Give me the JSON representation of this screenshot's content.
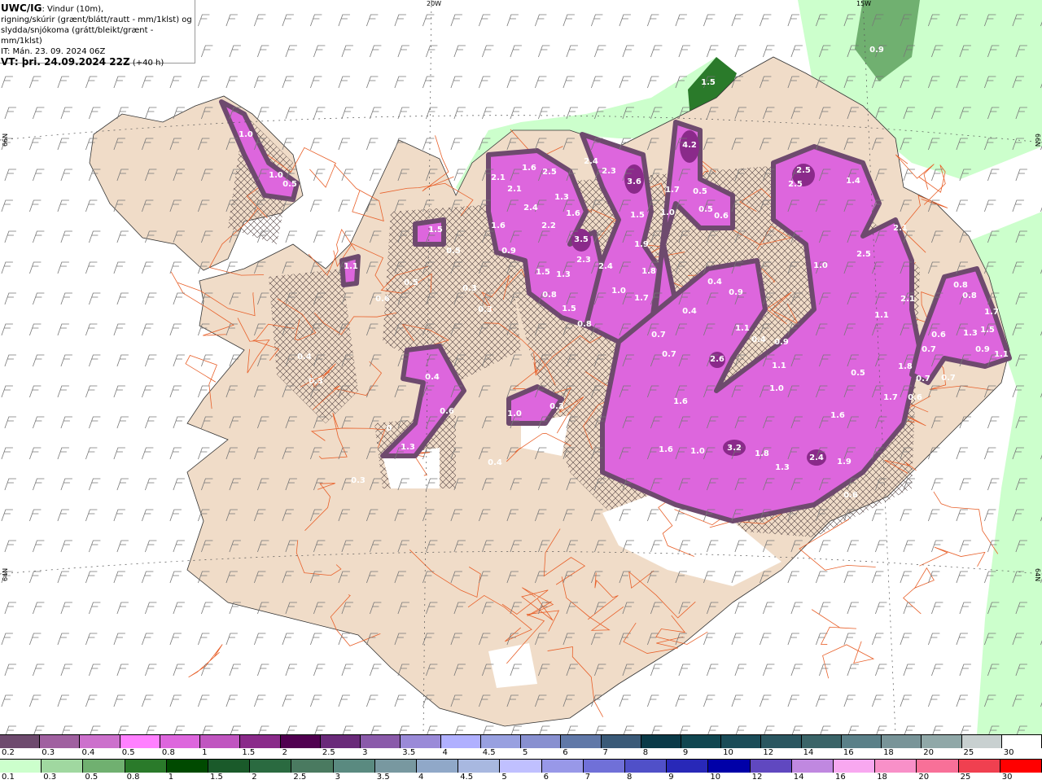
{
  "title": {
    "model": "UWC/IG",
    "line1_rest": ": Vindur (10m),",
    "line2": "rigning/skúrir (grænt/blátt/rautt - mm/1klst) og",
    "line3": "slydda/snjókoma (grátt/bleikt/grænt - mm/1klst)",
    "it": "IT: Mán. 23. 09. 2024 06Z",
    "vt_bold": "VT: þri. 24.09.2024 22Z",
    "vt_lead": "(+40 h)"
  },
  "map": {
    "colors": {
      "land": "#f0dcc8",
      "sea": "#ffffff",
      "roads": "#e8602a",
      "glacier": "#ffffff",
      "hatch": "#554444",
      "wind_barb": "#777777"
    },
    "coordinate_labels": {
      "lon_20w": "20W",
      "lon_15w": "15W",
      "lat_left_top": "66N",
      "lat_left_bottom": "64N",
      "lat_right_top": "66N",
      "lat_right_bottom": "64N"
    },
    "precip_labels": [
      "1.0",
      "1.0",
      "0.5",
      "1.1",
      "1.5",
      "0.5",
      "0.5",
      "0.6",
      "0.3",
      "0.3",
      "0.4",
      "0.3",
      "0.4",
      "0.6",
      "1.3",
      "1.0",
      "0.3",
      "0.4",
      "0.3",
      "0",
      "2.1",
      "1.6",
      "2.5",
      "2.1",
      "2.4",
      "1.3",
      "1.6",
      "1.6",
      "2.2",
      "0.9",
      "3.5",
      "2.3",
      "1.5",
      "1.3",
      "0.8",
      "1.5",
      "0.8",
      "2.4",
      "2.3",
      "3.6",
      "1.5",
      "4.2",
      "1.7",
      "1.0",
      "0.5",
      "0.5",
      "0.6",
      "1.9",
      "1.8",
      "2.4",
      "1.0",
      "1.7",
      "0.7",
      "0.7",
      "0.4",
      "0.4",
      "0.9",
      "1.1",
      "0.4",
      "2.6",
      "0.9",
      "1.1",
      "1.0",
      "1.6",
      "1.6",
      "1.0",
      "3.2",
      "1.8",
      "1.3",
      "2.4",
      "1.9",
      "0.6",
      "1.6",
      "0.5",
      "1.7",
      "0.6",
      "1.8",
      "1.1",
      "2.1",
      "1.0",
      "2.5",
      "2.1",
      "2.5",
      "2.5",
      "1.4",
      "0.9",
      "1.5",
      "0.8",
      "0.8",
      "1.7",
      "1.3",
      "1.5",
      "0.9",
      "1.1",
      "0.6",
      "0.7",
      "0.7",
      "0.7",
      "0.7"
    ]
  },
  "legend": {
    "snow": {
      "labels": [
        "0.2",
        "0.3",
        "0.4",
        "0.5",
        "0.8",
        "1",
        "1.5",
        "2",
        "2.5",
        "3",
        "3.5",
        "4",
        "4.5",
        "5",
        "6",
        "7",
        "8",
        "9",
        "10",
        "12",
        "14",
        "16",
        "18",
        "20",
        "25",
        "30"
      ],
      "colors": [
        "#6e4a6e",
        "#a060a0",
        "#cc70cc",
        "#ff80ff",
        "#dd66dd",
        "#c055c0",
        "#8a2a8a",
        "#500050",
        "#6a2a7a",
        "#8a5aaa",
        "#9a8ad8",
        "#b0b0ff",
        "#98a0e0",
        "#8890d0",
        "#6078a8",
        "#3a5a78",
        "#0a3a48",
        "#104650",
        "#1a4c58",
        "#2a5660",
        "#3a6468",
        "#5a8088",
        "#789498",
        "#90a8a8",
        "#c8d0d0",
        "#ffffff"
      ]
    },
    "rain": {
      "labels": [
        "0.1",
        "0.3",
        "0.5",
        "0.8",
        "1",
        "1.5",
        "2",
        "2.5",
        "3",
        "3.5",
        "4",
        "4.5",
        "5",
        "6",
        "7",
        "8",
        "9",
        "10",
        "12",
        "14",
        "16",
        "18",
        "20",
        "25",
        "30"
      ],
      "colors": [
        "#ccffcc",
        "#a0d8a0",
        "#70b070",
        "#2a7a2a",
        "#004a00",
        "#1a5a2a",
        "#2a6a40",
        "#4a7a60",
        "#5a8a80",
        "#7898a0",
        "#90a8c8",
        "#a8b8e0",
        "#c0c0ff",
        "#9898e8",
        "#7070d8",
        "#5050c8",
        "#2828b8",
        "#0000a8",
        "#6048c0",
        "#c088e0",
        "#f8a8f0",
        "#f890c8",
        "#f87098",
        "#f04050",
        "#ff0000"
      ]
    }
  }
}
